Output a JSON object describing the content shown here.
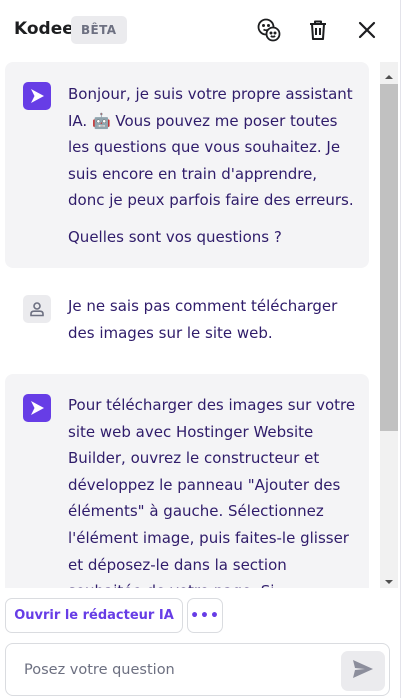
{
  "header": {
    "title": "Kodee",
    "badge": "BÊTA"
  },
  "messages": [
    {
      "role": "ai",
      "paragraphs": [
        "Bonjour, je suis votre propre assistant IA. 🤖 Vous pouvez me poser toutes les questions que vous souhaitez. Je suis encore en train d'apprendre, donc je peux parfois faire des erreurs.",
        "Quelles sont vos questions ?"
      ]
    },
    {
      "role": "user",
      "text": "Je ne sais pas comment télécharger des images sur le site web."
    },
    {
      "role": "ai",
      "text": "Pour télécharger des images sur votre site web avec Hostinger Website Builder, ouvrez le constructeur et développez le panneau \"Ajouter des éléments\" à gauche. Sélectionnez l'élément image, puis faites-le glisser et déposez-le dans la section souhaitée de votre page. Si"
    }
  ],
  "actions": {
    "editor_label": "Ouvrir le rédacteur IA",
    "more_label": "•••"
  },
  "composer": {
    "placeholder": "Posez votre question"
  },
  "icons": {
    "emoji": "emoji-icon",
    "trash": "trash-icon",
    "close": "close-icon",
    "ai_avatar": "kodee-logo-icon",
    "user_avatar": "user-icon",
    "send": "send-icon"
  },
  "colors": {
    "accent": "#673de6",
    "text": "#2f1c6a",
    "bubble": "#f4f4f6"
  }
}
